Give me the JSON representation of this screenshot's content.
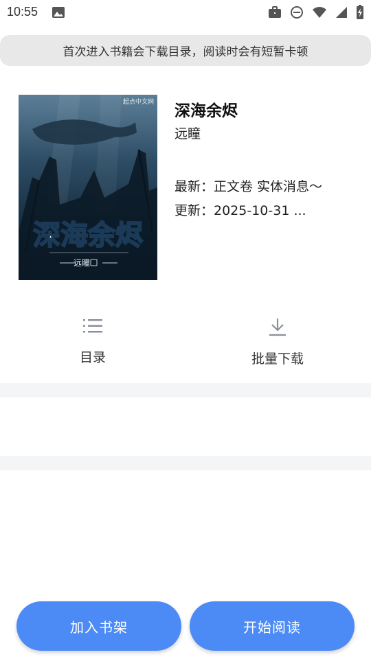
{
  "status_bar": {
    "time": "10:55",
    "icons": [
      "photo-icon",
      "briefcase-icon",
      "dnd-icon",
      "wifi-icon",
      "signal-icon",
      "battery-icon"
    ]
  },
  "notice": {
    "text": "首次进入书籍会下载目录，阅读时会有短暂卡顿"
  },
  "book": {
    "title": "深海余烬",
    "author": "远瞳",
    "latest": "最新：正文卷 实体消息～",
    "updated": "更新：2025-10-31 ...",
    "cover": {
      "title_art": "深海余烬",
      "author_art": "远瞳",
      "publisher": "起点中文网"
    }
  },
  "actions": {
    "catalog_label": "目录",
    "download_label": "批量下载"
  },
  "buttons": {
    "add_shelf": "加入书架",
    "start_reading": "开始阅读"
  },
  "colors": {
    "accent": "#4c8bf5",
    "notice_bg": "#e8e8e8",
    "band_bg": "#f4f5f7"
  }
}
